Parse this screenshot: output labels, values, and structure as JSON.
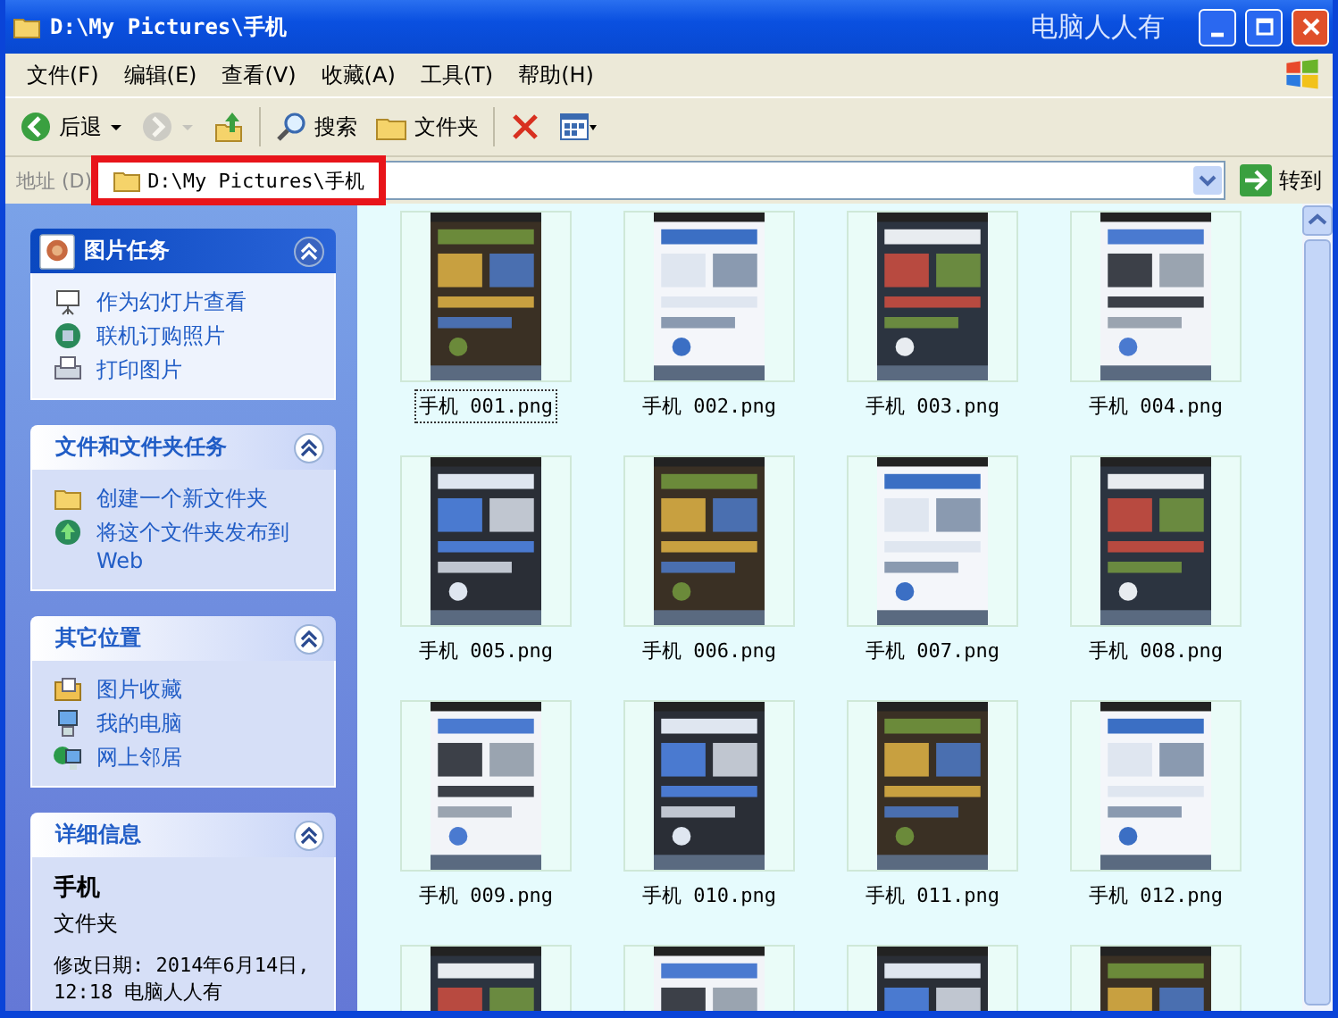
{
  "window": {
    "title": "D:\\My Pictures\\手机",
    "title_tag": "电脑人人有"
  },
  "menu": [
    "文件(F)",
    "编辑(E)",
    "查看(V)",
    "收藏(A)",
    "工具(T)",
    "帮助(H)"
  ],
  "toolbar": [
    {
      "kind": "back",
      "label": "后退",
      "disabled": false
    },
    {
      "kind": "forward",
      "disabled": true
    },
    {
      "kind": "up",
      "disabled": false
    },
    {
      "kind": "search",
      "label": "搜索",
      "disabled": false
    },
    {
      "kind": "folders",
      "label": "文件夹",
      "disabled": false
    },
    {
      "kind": "delete",
      "disabled": false
    },
    {
      "kind": "views",
      "disabled": false
    }
  ],
  "address_bar": {
    "label": "地址 (D)",
    "value": "D:\\My Pictures\\手机",
    "highlighted": true,
    "go_label": "转到"
  },
  "sidebar": [
    {
      "kind": "special",
      "title": "图片任务",
      "expanded": true,
      "items": [
        {
          "label": "作为幻灯片查看"
        },
        {
          "label": "联机订购照片"
        },
        {
          "label": "打印图片"
        }
      ]
    },
    {
      "kind": "normal",
      "title": "文件和文件夹任务",
      "expanded": true,
      "items": [
        {
          "label": "创建一个新文件夹"
        },
        {
          "label": "将这个文件夹发布到 Web"
        }
      ]
    },
    {
      "kind": "normal",
      "title": "其它位置",
      "expanded": true,
      "items": [
        {
          "label": "图片收藏"
        },
        {
          "label": "我的电脑"
        },
        {
          "label": "网上邻居"
        }
      ]
    },
    {
      "kind": "details",
      "title": "详细信息",
      "expanded": true,
      "name": "手机",
      "type": "文件夹",
      "modified": "修改日期: 2014年6月14日, 12:18 电脑人人有"
    }
  ],
  "files": [
    {
      "name": "手机 001.png",
      "selected": true
    },
    {
      "name": "手机 002.png",
      "selected": false
    },
    {
      "name": "手机 003.png",
      "selected": false
    },
    {
      "name": "手机 004.png",
      "selected": false
    },
    {
      "name": "手机 005.png",
      "selected": false
    },
    {
      "name": "手机 006.png",
      "selected": false
    },
    {
      "name": "手机 007.png",
      "selected": false
    },
    {
      "name": "手机 008.png",
      "selected": false
    },
    {
      "name": "手机 009.png",
      "selected": false
    },
    {
      "name": "手机 010.png",
      "selected": false
    },
    {
      "name": "手机 011.png",
      "selected": false
    },
    {
      "name": "手机 012.png",
      "selected": false
    }
  ],
  "partial_row": [
    {
      "kind": "picture"
    },
    {
      "kind": "picture"
    },
    {
      "kind": "picture"
    },
    {
      "kind": "picture"
    }
  ]
}
